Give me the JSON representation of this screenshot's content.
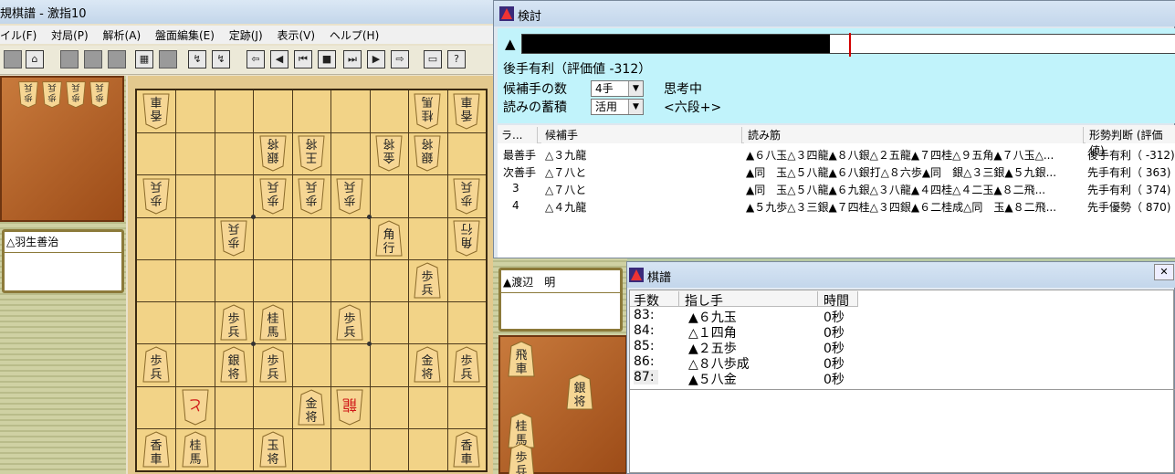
{
  "main_window": {
    "title": "規棋譜 - 激指10",
    "menu": [
      "イル(F)",
      "対局(P)",
      "解析(A)",
      "盤面編集(E)",
      "定跡(J)",
      "表示(V)",
      "ヘルプ(H)"
    ]
  },
  "players": {
    "white": "△羽生善治",
    "black": "▲渡辺　明"
  },
  "analysis": {
    "title": "検討",
    "evalbar_mark": "▲",
    "black_fraction": 0.47,
    "eval_text": "後手有利（評価値 -312）",
    "candidates_label": "候補手の数",
    "candidates_value": "4手",
    "thinking": "思考中",
    "accumulate_label": "読みの蓄積",
    "accumulate_value": "活用",
    "rank": "<六段+>",
    "columns": [
      "ラ...",
      "候補手",
      "読み筋",
      "形勢判断 (評価値)"
    ],
    "rows": [
      {
        "rank": "最善手",
        "move": "△３九龍",
        "line": "▲６八玉△３四龍▲８八銀△２五龍▲７四桂△９五角▲７八玉△...",
        "judgement": "後手有利（ -312)"
      },
      {
        "rank": "次善手",
        "move": "△７八と",
        "line": "▲同　玉△５八龍▲６八銀打△８六歩▲同　銀△３三銀▲５九銀...",
        "judgement": "先手有利（  363)"
      },
      {
        "rank": "3",
        "move": "△７八と",
        "line": "▲同　玉△５八龍▲６九銀△３八龍▲４四桂△４二玉▲８二飛...",
        "judgement": "先手有利（  374)"
      },
      {
        "rank": "4",
        "move": "△４九龍",
        "line": "▲５九歩△３三銀▲７四桂△３四銀▲６二桂成△同　玉▲８二飛...",
        "judgement": "先手優勢（  870)"
      }
    ]
  },
  "kifu": {
    "title": "棋譜",
    "close_label": "✕",
    "columns": [
      "手数",
      "指し手",
      "時間"
    ],
    "rows": [
      {
        "num": "83:",
        "move": "▲６九玉",
        "time": "0秒"
      },
      {
        "num": "84:",
        "move": "△１四角",
        "time": "0秒"
      },
      {
        "num": "85:",
        "move": "▲２五歩",
        "time": "0秒"
      },
      {
        "num": "86:",
        "move": "△８八歩成",
        "time": "0秒"
      },
      {
        "num": "87:",
        "move": "▲５八金",
        "time": "0秒"
      }
    ]
  },
  "board": {
    "pieces": [
      {
        "col": 9,
        "row": 1,
        "name": "香",
        "sub": "車",
        "gote": true,
        "promo": false
      },
      {
        "col": 2,
        "row": 1,
        "name": "桂",
        "sub": "馬",
        "gote": true,
        "promo": false
      },
      {
        "col": 1,
        "row": 1,
        "name": "香",
        "sub": "車",
        "gote": true,
        "promo": false
      },
      {
        "col": 6,
        "row": 2,
        "name": "銀",
        "sub": "将",
        "gote": true,
        "promo": false
      },
      {
        "col": 5,
        "row": 2,
        "name": "王",
        "sub": "将",
        "gote": true,
        "promo": false
      },
      {
        "col": 3,
        "row": 2,
        "name": "金",
        "sub": "将",
        "gote": true,
        "promo": false
      },
      {
        "col": 2,
        "row": 2,
        "name": "銀",
        "sub": "将",
        "gote": true,
        "promo": false
      },
      {
        "col": 9,
        "row": 3,
        "name": "歩",
        "sub": "兵",
        "gote": true,
        "promo": false
      },
      {
        "col": 6,
        "row": 3,
        "name": "歩",
        "sub": "兵",
        "gote": true,
        "promo": false
      },
      {
        "col": 5,
        "row": 3,
        "name": "歩",
        "sub": "兵",
        "gote": true,
        "promo": false
      },
      {
        "col": 4,
        "row": 3,
        "name": "歩",
        "sub": "兵",
        "gote": true,
        "promo": false
      },
      {
        "col": 1,
        "row": 3,
        "name": "歩",
        "sub": "兵",
        "gote": true,
        "promo": false
      },
      {
        "col": 7,
        "row": 4,
        "name": "歩",
        "sub": "兵",
        "gote": true,
        "promo": false
      },
      {
        "col": 3,
        "row": 4,
        "name": "角",
        "sub": "行",
        "gote": false,
        "promo": false
      },
      {
        "col": 1,
        "row": 4,
        "name": "角",
        "sub": "行",
        "gote": true,
        "promo": false
      },
      {
        "col": 2,
        "row": 5,
        "name": "歩",
        "sub": "兵",
        "gote": false,
        "promo": false
      },
      {
        "col": 7,
        "row": 6,
        "name": "歩",
        "sub": "兵",
        "gote": false,
        "promo": false
      },
      {
        "col": 6,
        "row": 6,
        "name": "桂",
        "sub": "馬",
        "gote": false,
        "promo": false
      },
      {
        "col": 4,
        "row": 6,
        "name": "歩",
        "sub": "兵",
        "gote": false,
        "promo": false
      },
      {
        "col": 9,
        "row": 7,
        "name": "歩",
        "sub": "兵",
        "gote": false,
        "promo": false
      },
      {
        "col": 7,
        "row": 7,
        "name": "銀",
        "sub": "将",
        "gote": false,
        "promo": false
      },
      {
        "col": 6,
        "row": 7,
        "name": "歩",
        "sub": "兵",
        "gote": false,
        "promo": false
      },
      {
        "col": 2,
        "row": 7,
        "name": "金",
        "sub": "将",
        "gote": false,
        "promo": false
      },
      {
        "col": 1,
        "row": 7,
        "name": "歩",
        "sub": "兵",
        "gote": false,
        "promo": false
      },
      {
        "col": 8,
        "row": 8,
        "name": "と",
        "sub": "",
        "gote": true,
        "promo": true
      },
      {
        "col": 5,
        "row": 8,
        "name": "金",
        "sub": "将",
        "gote": false,
        "promo": false
      },
      {
        "col": 4,
        "row": 8,
        "name": "龍",
        "sub": "",
        "gote": true,
        "promo": true
      },
      {
        "col": 9,
        "row": 9,
        "name": "香",
        "sub": "車",
        "gote": false,
        "promo": false
      },
      {
        "col": 8,
        "row": 9,
        "name": "桂",
        "sub": "馬",
        "gote": false,
        "promo": false
      },
      {
        "col": 6,
        "row": 9,
        "name": "玉",
        "sub": "将",
        "gote": false,
        "promo": false
      },
      {
        "col": 1,
        "row": 9,
        "name": "香",
        "sub": "車",
        "gote": false,
        "promo": false
      }
    ],
    "hand_white": [
      "歩",
      "歩",
      "歩",
      "歩"
    ],
    "hand_black": [
      {
        "name": "飛",
        "sub": "車"
      },
      {
        "name": "銀",
        "sub": "将"
      },
      {
        "name": "桂",
        "sub": "馬"
      },
      {
        "name": "歩",
        "sub": "兵"
      }
    ]
  },
  "colors": {
    "board": "#f2d387",
    "eval_panel": "#c1f3fb",
    "eval_marker": "#d10000"
  }
}
